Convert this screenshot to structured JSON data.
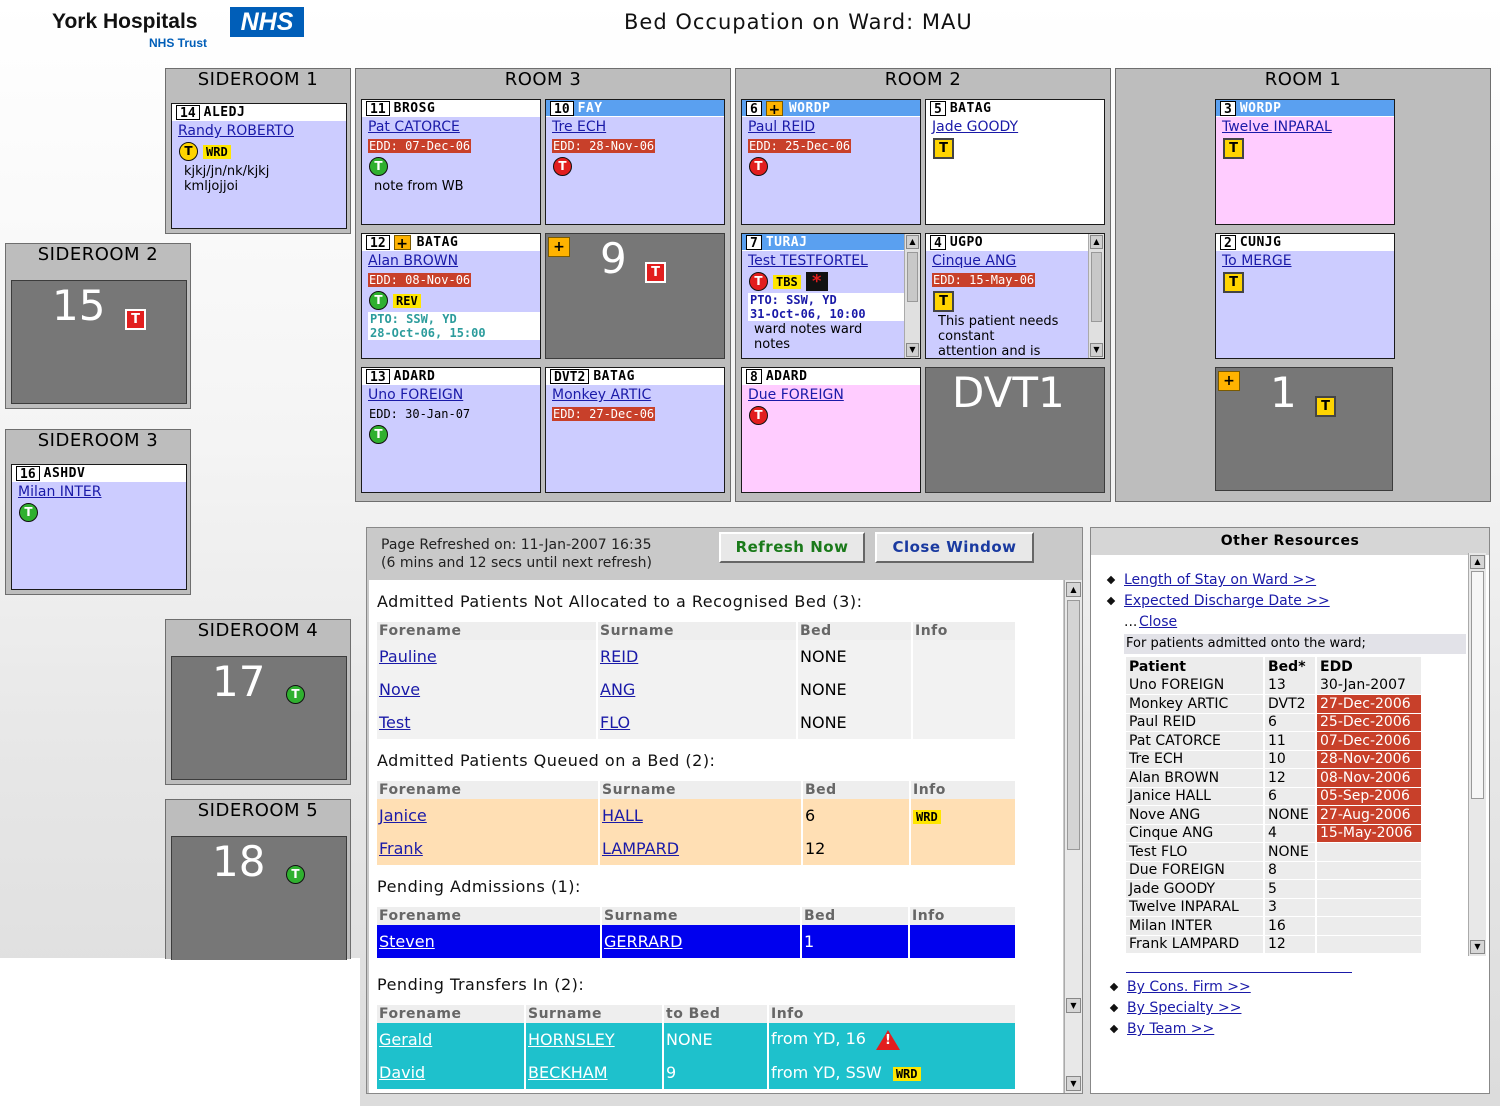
{
  "header": {
    "org_name": "York Hospitals",
    "nhs_logo": "NHS",
    "trust": "NHS Trust",
    "title": "Bed Occupation on Ward: MAU"
  },
  "rooms": {
    "sideroom1": {
      "title": "SIDEROOM 1",
      "bed": {
        "num": "14",
        "code": "ALEDJ",
        "patient": "Randy ROBERTO",
        "tag": "WRD",
        "icon": "T",
        "note": "kjkj/jn/nk/kjkj\nkmljojjoi"
      }
    },
    "sideroom2": {
      "title": "SIDEROOM 2",
      "num": "15",
      "icon": "T"
    },
    "sideroom3": {
      "title": "SIDEROOM 3",
      "bed": {
        "num": "16",
        "code": "ASHDV",
        "patient": "Milan INTER",
        "icon": "T"
      }
    },
    "sideroom4": {
      "title": "SIDEROOM 4",
      "num": "17",
      "icon": "T"
    },
    "sideroom5": {
      "title": "SIDEROOM 5",
      "num": "18",
      "icon": "T"
    },
    "room3": {
      "title": "ROOM 3",
      "b11": {
        "num": "11",
        "code": "BROSG",
        "patient": "Pat CATORCE",
        "edd": "EDD: 07-Dec-06",
        "icon": "T",
        "note": "note from WB"
      },
      "b10": {
        "num": "10",
        "code": "FAY",
        "patient": "Tre ECH",
        "edd": "EDD: 28-Nov-06",
        "icon": "T"
      },
      "b12": {
        "num": "12",
        "plus": "+",
        "code": "BATAG",
        "patient": "Alan BROWN",
        "edd": "EDD: 08-Nov-06",
        "icon": "T",
        "tag": "REV",
        "pto1": "PTO: SSW, YD",
        "pto2": "28-Oct-06, 15:00"
      },
      "b9": {
        "plus": "+",
        "num": "9",
        "icon": "T"
      },
      "b13": {
        "num": "13",
        "code": "ADARD",
        "patient": "Uno FOREIGN",
        "edd": "EDD: 30-Jan-07",
        "icon": "T"
      },
      "bdvt2": {
        "num": "DVT2",
        "code": "BATAG",
        "patient": "Monkey ARTIC",
        "edd": "EDD: 27-Dec-06"
      }
    },
    "room2": {
      "title": "ROOM 2",
      "b6": {
        "num": "6",
        "plus": "+",
        "code": "WORDP",
        "patient": "Paul REID",
        "edd": "EDD: 25-Dec-06",
        "icon": "T"
      },
      "b5": {
        "num": "5",
        "code": "BATAG",
        "patient": "Jade GOODY",
        "icon": "T"
      },
      "b7": {
        "num": "7",
        "code": "TURAJ",
        "patient": "Test TESTFORTEL",
        "icon": "T",
        "tag": "TBS",
        "star": "*",
        "pto1": "PTO: SSW, YD",
        "pto2": "31-Oct-06, 10:00",
        "note": "ward notes ward\nnotes"
      },
      "b4": {
        "num": "4",
        "code": "UGPO",
        "patient": "Cinque ANG",
        "edd": "EDD: 15-May-06",
        "icon": "T",
        "note": "This patient needs\nconstant\nattention and is"
      },
      "b8": {
        "num": "8",
        "code": "ADARD",
        "patient": "Due FOREIGN",
        "icon": "T"
      },
      "bdvt1": {
        "num": "DVT1"
      }
    },
    "room1": {
      "title": "ROOM 1",
      "b3": {
        "num": "3",
        "code": "WORDP",
        "patient": "Twelve INPARAL",
        "icon": "T"
      },
      "b2": {
        "num": "2",
        "code": "CUNJG",
        "patient": "To MERGE",
        "icon": "T"
      },
      "b1": {
        "plus": "+",
        "num": "1",
        "icon": "T"
      }
    }
  },
  "info": {
    "refreshed": "Page Refreshed on: 11-Jan-2007 16:35",
    "countdown": "(6 mins and 12 secs until next refresh)",
    "refresh_btn": "Refresh Now",
    "close_btn": "Close Window",
    "unallocated": {
      "title": "Admitted Patients Not Allocated to a Recognised Bed (3):",
      "headers": [
        "Forename",
        "Surname",
        "Bed",
        "Info"
      ],
      "rows": [
        {
          "forename": "Pauline",
          "surname": "REID",
          "bed": "NONE",
          "info": ""
        },
        {
          "forename": "Nove",
          "surname": "ANG",
          "bed": "NONE",
          "info": ""
        },
        {
          "forename": "Test",
          "surname": "FLO",
          "bed": "NONE",
          "info": ""
        }
      ]
    },
    "queued": {
      "title": "Admitted Patients Queued on a Bed (2):",
      "headers": [
        "Forename",
        "Surname",
        "Bed",
        "Info"
      ],
      "rows": [
        {
          "forename": "Janice",
          "surname": "HALL",
          "bed": "6",
          "info": "WRD"
        },
        {
          "forename": "Frank",
          "surname": "LAMPARD",
          "bed": "12",
          "info": ""
        }
      ]
    },
    "pending": {
      "title": "Pending Admissions (1):",
      "headers": [
        "Forename",
        "Surname",
        "Bed",
        "Info"
      ],
      "rows": [
        {
          "forename": "Steven",
          "surname": "GERRARD",
          "bed": "1",
          "info": ""
        }
      ]
    },
    "transfers": {
      "title": "Pending Transfers In (2):",
      "headers": [
        "Forename",
        "Surname",
        "to Bed",
        "Info"
      ],
      "rows": [
        {
          "forename": "Gerald",
          "surname": "HORNSLEY",
          "bed": "NONE",
          "info": "from YD, 16"
        },
        {
          "forename": "David",
          "surname": "BECKHAM",
          "bed": "9",
          "info": "from YD, SSW",
          "tag": "WRD"
        }
      ]
    }
  },
  "other": {
    "title": "Other Resources",
    "links": [
      "Length of Stay on Ward >>",
      "Expected Discharge Date >>"
    ],
    "close_prefix": "...",
    "close": "Close",
    "admitted_note": "For patients admitted onto the ward;",
    "los_headers": [
      "Patient",
      "Bed*",
      "EDD"
    ],
    "los_rows": [
      {
        "patient": "Uno FOREIGN",
        "bed": "13",
        "edd": "30-Jan-2007",
        "overdue": false
      },
      {
        "patient": "Monkey ARTIC",
        "bed": "DVT2",
        "edd": "27-Dec-2006",
        "overdue": true
      },
      {
        "patient": "Paul REID",
        "bed": "6",
        "edd": "25-Dec-2006",
        "overdue": true
      },
      {
        "patient": "Pat CATORCE",
        "bed": "11",
        "edd": "07-Dec-2006",
        "overdue": true
      },
      {
        "patient": "Tre ECH",
        "bed": "10",
        "edd": "28-Nov-2006",
        "overdue": true
      },
      {
        "patient": "Alan BROWN",
        "bed": "12",
        "edd": "08-Nov-2006",
        "overdue": true
      },
      {
        "patient": "Janice HALL",
        "bed": "6",
        "edd": "05-Sep-2006",
        "overdue": true
      },
      {
        "patient": "Nove ANG",
        "bed": "NONE",
        "edd": "27-Aug-2006",
        "overdue": true
      },
      {
        "patient": "Cinque ANG",
        "bed": "4",
        "edd": "15-May-2006",
        "overdue": true
      },
      {
        "patient": "Test FLO",
        "bed": "NONE",
        "edd": "",
        "overdue": false
      },
      {
        "patient": "Due FOREIGN",
        "bed": "8",
        "edd": "",
        "overdue": false
      },
      {
        "patient": "Jade GOODY",
        "bed": "5",
        "edd": "",
        "overdue": false
      },
      {
        "patient": "Twelve INPARAL",
        "bed": "3",
        "edd": "",
        "overdue": false
      },
      {
        "patient": "Milan INTER",
        "bed": "16",
        "edd": "",
        "overdue": false
      },
      {
        "patient": "Frank LAMPARD",
        "bed": "12",
        "edd": "",
        "overdue": false
      }
    ],
    "bottom_links": [
      "By Cons. Firm >>",
      "By Specialty >>",
      "By Team >>"
    ]
  },
  "colors": {
    "bed_occupied": "#ccccff",
    "bed_female": "#ffccff",
    "bed_empty": "#777777",
    "edd_overdue": "#c8402a",
    "queued_row": "#ffdfb4",
    "pending_row": "#0000ee",
    "transfer_row": "#1ec1cc"
  }
}
